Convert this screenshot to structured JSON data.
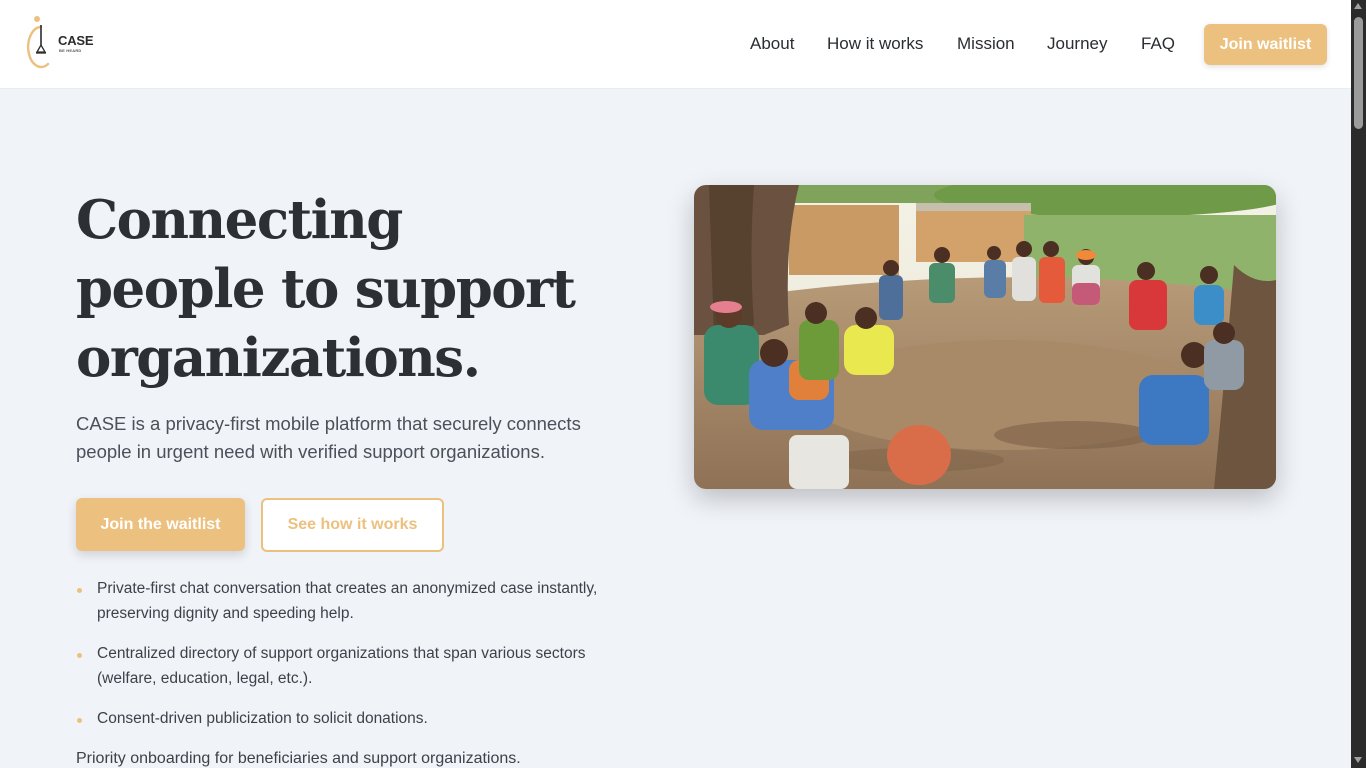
{
  "brand": {
    "name": "CASE",
    "tagline": "BE HEARD",
    "accent_color": "#ecc07f"
  },
  "nav": {
    "items": [
      {
        "label": "About"
      },
      {
        "label": "How it works"
      },
      {
        "label": "Mission"
      },
      {
        "label": "Journey"
      },
      {
        "label": "FAQ"
      }
    ],
    "cta_label": "Join waitlist"
  },
  "hero": {
    "title_lines": [
      "Connecting",
      "people to support",
      "organizations."
    ],
    "subtitle": "CASE is a privacy-first mobile platform that securely connects people in urgent need with verified support organizations.",
    "primary_cta": "Join the waitlist",
    "secondary_cta": "See how it works",
    "features": [
      "Private-first chat conversation that creates an anonymized case instantly, preserving dignity and speeding help.",
      "Centralized directory of support organizations that span various sectors (welfare, education, legal, etc.).",
      "Consent-driven publicization to solicit donations."
    ],
    "priority_note": "Priority onboarding for beneficiaries and support organizations.",
    "image_icon": "community-meeting-photo"
  }
}
